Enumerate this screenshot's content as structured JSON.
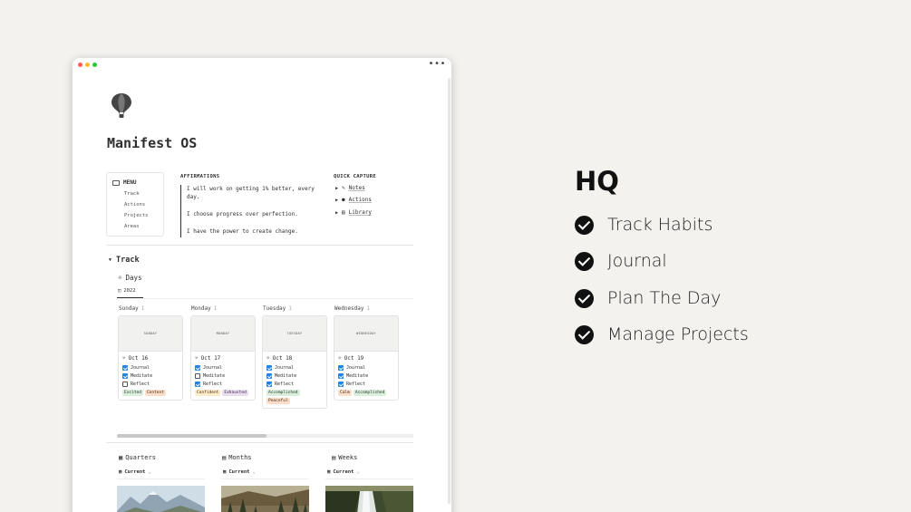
{
  "window": {
    "more_label": "•••"
  },
  "page": {
    "title": "Manifest OS",
    "icon": "hot-air-balloon-icon"
  },
  "menu": {
    "heading": "MENU",
    "items": [
      "Track",
      "Actions",
      "Projects",
      "Areas"
    ]
  },
  "affirmations": {
    "heading": "AFFIRMATIONS",
    "lines": [
      "I will work on getting 1% better, every day.",
      "I choose progress over perfection.",
      "I have the power to create change."
    ]
  },
  "quick_capture": {
    "heading": "QUICK CAPTURE",
    "items": [
      {
        "label": "Notes",
        "icon": "notes-icon"
      },
      {
        "label": "Actions",
        "icon": "actions-icon"
      },
      {
        "label": "Library",
        "icon": "library-icon"
      }
    ]
  },
  "track": {
    "heading": "Track",
    "days_label": "Days",
    "view_tab": "2022",
    "columns": [
      {
        "name": "Sunday",
        "count": "1",
        "cover": "SUNDAY",
        "date": "Oct 16",
        "checks": [
          {
            "label": "Journal",
            "checked": true
          },
          {
            "label": "Meditate",
            "checked": true
          },
          {
            "label": "Reflect",
            "checked": false
          }
        ],
        "tags": [
          {
            "label": "Excited",
            "bg": "#dbeddb",
            "fg": "#1c3829"
          },
          {
            "label": "Content",
            "bg": "#fadec9",
            "fg": "#49290e"
          }
        ]
      },
      {
        "name": "Monday",
        "count": "1",
        "cover": "MONDAY",
        "date": "Oct 17",
        "checks": [
          {
            "label": "Journal",
            "checked": true
          },
          {
            "label": "Meditate",
            "checked": false
          },
          {
            "label": "Reflect",
            "checked": true
          }
        ],
        "tags": [
          {
            "label": "Confident",
            "bg": "#fdecc8",
            "fg": "#402c1b"
          },
          {
            "label": "Exhausted",
            "bg": "#e8deee",
            "fg": "#412454"
          }
        ]
      },
      {
        "name": "Tuesday",
        "count": "1",
        "cover": "TUESDAY",
        "date": "Oct 18",
        "checks": [
          {
            "label": "Journal",
            "checked": true
          },
          {
            "label": "Meditate",
            "checked": true
          },
          {
            "label": "Reflect",
            "checked": true
          }
        ],
        "tags": [
          {
            "label": "Accomplished",
            "bg": "#dbeddb",
            "fg": "#1c3829"
          },
          {
            "label": "Peaceful",
            "bg": "#fadec9",
            "fg": "#49290e"
          }
        ]
      },
      {
        "name": "Wednesday",
        "count": "1",
        "cover": "WEDNESDAY",
        "date": "Oct 19",
        "checks": [
          {
            "label": "Journal",
            "checked": true
          },
          {
            "label": "Meditate",
            "checked": true
          },
          {
            "label": "Reflect",
            "checked": true
          }
        ],
        "tags": [
          {
            "label": "Calm",
            "bg": "#fadec9",
            "fg": "#49290e"
          },
          {
            "label": "Accomplished",
            "bg": "#dbeddb",
            "fg": "#1c3829"
          }
        ]
      }
    ]
  },
  "databases": [
    {
      "name": "Quarters",
      "view": "Current",
      "icon": "quarters-icon",
      "image": "mountain-lake"
    },
    {
      "name": "Months",
      "view": "Current",
      "icon": "months-icon",
      "image": "forest-valley"
    },
    {
      "name": "Weeks",
      "view": "Current",
      "icon": "weeks-icon",
      "image": "waterfall"
    }
  ],
  "hq": {
    "title": "HQ",
    "items": [
      "Track Habits",
      "Journal",
      "Plan The Day",
      "Manage Projects"
    ]
  },
  "colors": {
    "checkbox": "#2383e2",
    "background": "#f3f2ef"
  }
}
